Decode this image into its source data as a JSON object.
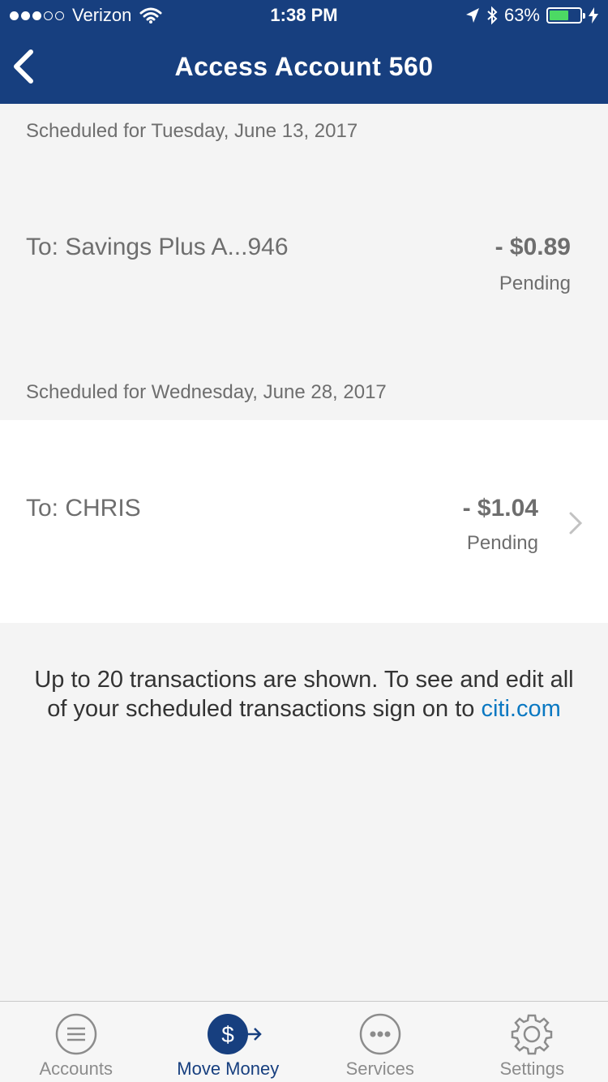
{
  "status_bar": {
    "carrier": "Verizon",
    "time": "1:38 PM",
    "battery_pct": "63%",
    "battery_level": 0.63,
    "signal_bars_filled": 3,
    "signal_bars_total": 5
  },
  "nav": {
    "title": "Access Account 560",
    "back_icon": "chevron-left-icon"
  },
  "sections": [
    {
      "date_label": "Scheduled for Tuesday, June 13, 2017",
      "transaction": {
        "to_label": "To: Savings Plus A...946",
        "amount": "- $0.89",
        "status": "Pending"
      }
    },
    {
      "date_label": "Scheduled for Wednesday, June 28, 2017",
      "transaction": {
        "to_label": "To: CHRIS",
        "amount": "- $1.04",
        "status": "Pending"
      }
    }
  ],
  "footer_note": {
    "text": "Up to 20 transactions are shown. To see and edit all of your scheduled transactions sign on to ",
    "link": "citi.com"
  },
  "tabbar": {
    "items": [
      {
        "label": "Accounts",
        "icon": "menu-lines-icon",
        "active": false
      },
      {
        "label": "Move Money",
        "icon": "dollar-transfer-icon",
        "active": true
      },
      {
        "label": "Services",
        "icon": "more-dots-icon",
        "active": false
      },
      {
        "label": "Settings",
        "icon": "gear-icon",
        "active": false
      }
    ]
  },
  "colors": {
    "header": "#173f7f",
    "background": "#f4f4f4",
    "link": "#0a78c2",
    "battery": "#4cd964"
  }
}
